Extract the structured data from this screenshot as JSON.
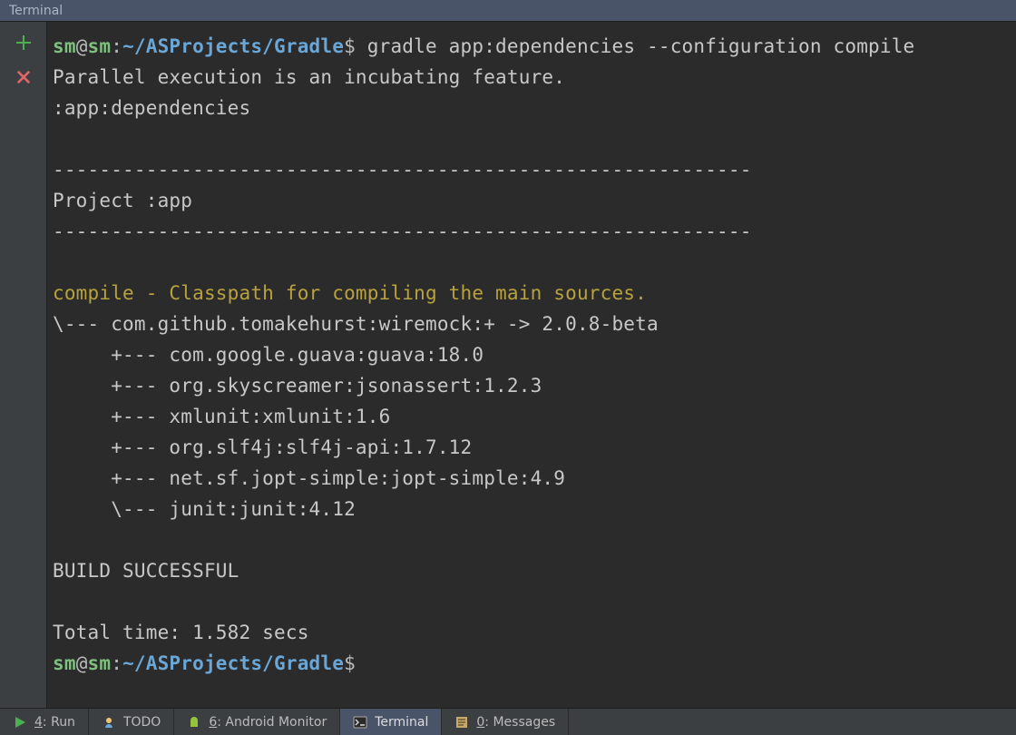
{
  "title": "Terminal",
  "prompt": {
    "user": "sm",
    "at": "@",
    "host": "sm",
    "colon": ":",
    "path": "~/ASProjects/Gradle",
    "dollar": "$"
  },
  "command": " gradle app:dependencies --configuration compile",
  "lines": {
    "parallel": "Parallel execution is an incubating feature.",
    "task": ":app:dependencies",
    "hr": "------------------------------------------------------------",
    "project": "Project :app",
    "compile": "compile - Classpath for compiling the main sources.",
    "dep0": "\\--- com.github.tomakehurst:wiremock:+ -> 2.0.8-beta",
    "dep1": "     +--- com.google.guava:guava:18.0",
    "dep2": "     +--- org.skyscreamer:jsonassert:1.2.3",
    "dep3": "     +--- xmlunit:xmlunit:1.6",
    "dep4": "     +--- org.slf4j:slf4j-api:1.7.12",
    "dep5": "     +--- net.sf.jopt-simple:jopt-simple:4.9",
    "dep6": "     \\--- junit:junit:4.12",
    "build": "BUILD SUCCESSFUL",
    "time": "Total time: 1.582 secs"
  },
  "footer": {
    "run_key": "4",
    "run_label": ": Run",
    "todo_label": "TODO",
    "android_key": "6",
    "android_label": ": Android Monitor",
    "terminal_label": "Terminal",
    "messages_key": "0",
    "messages_label": ": Messages"
  }
}
